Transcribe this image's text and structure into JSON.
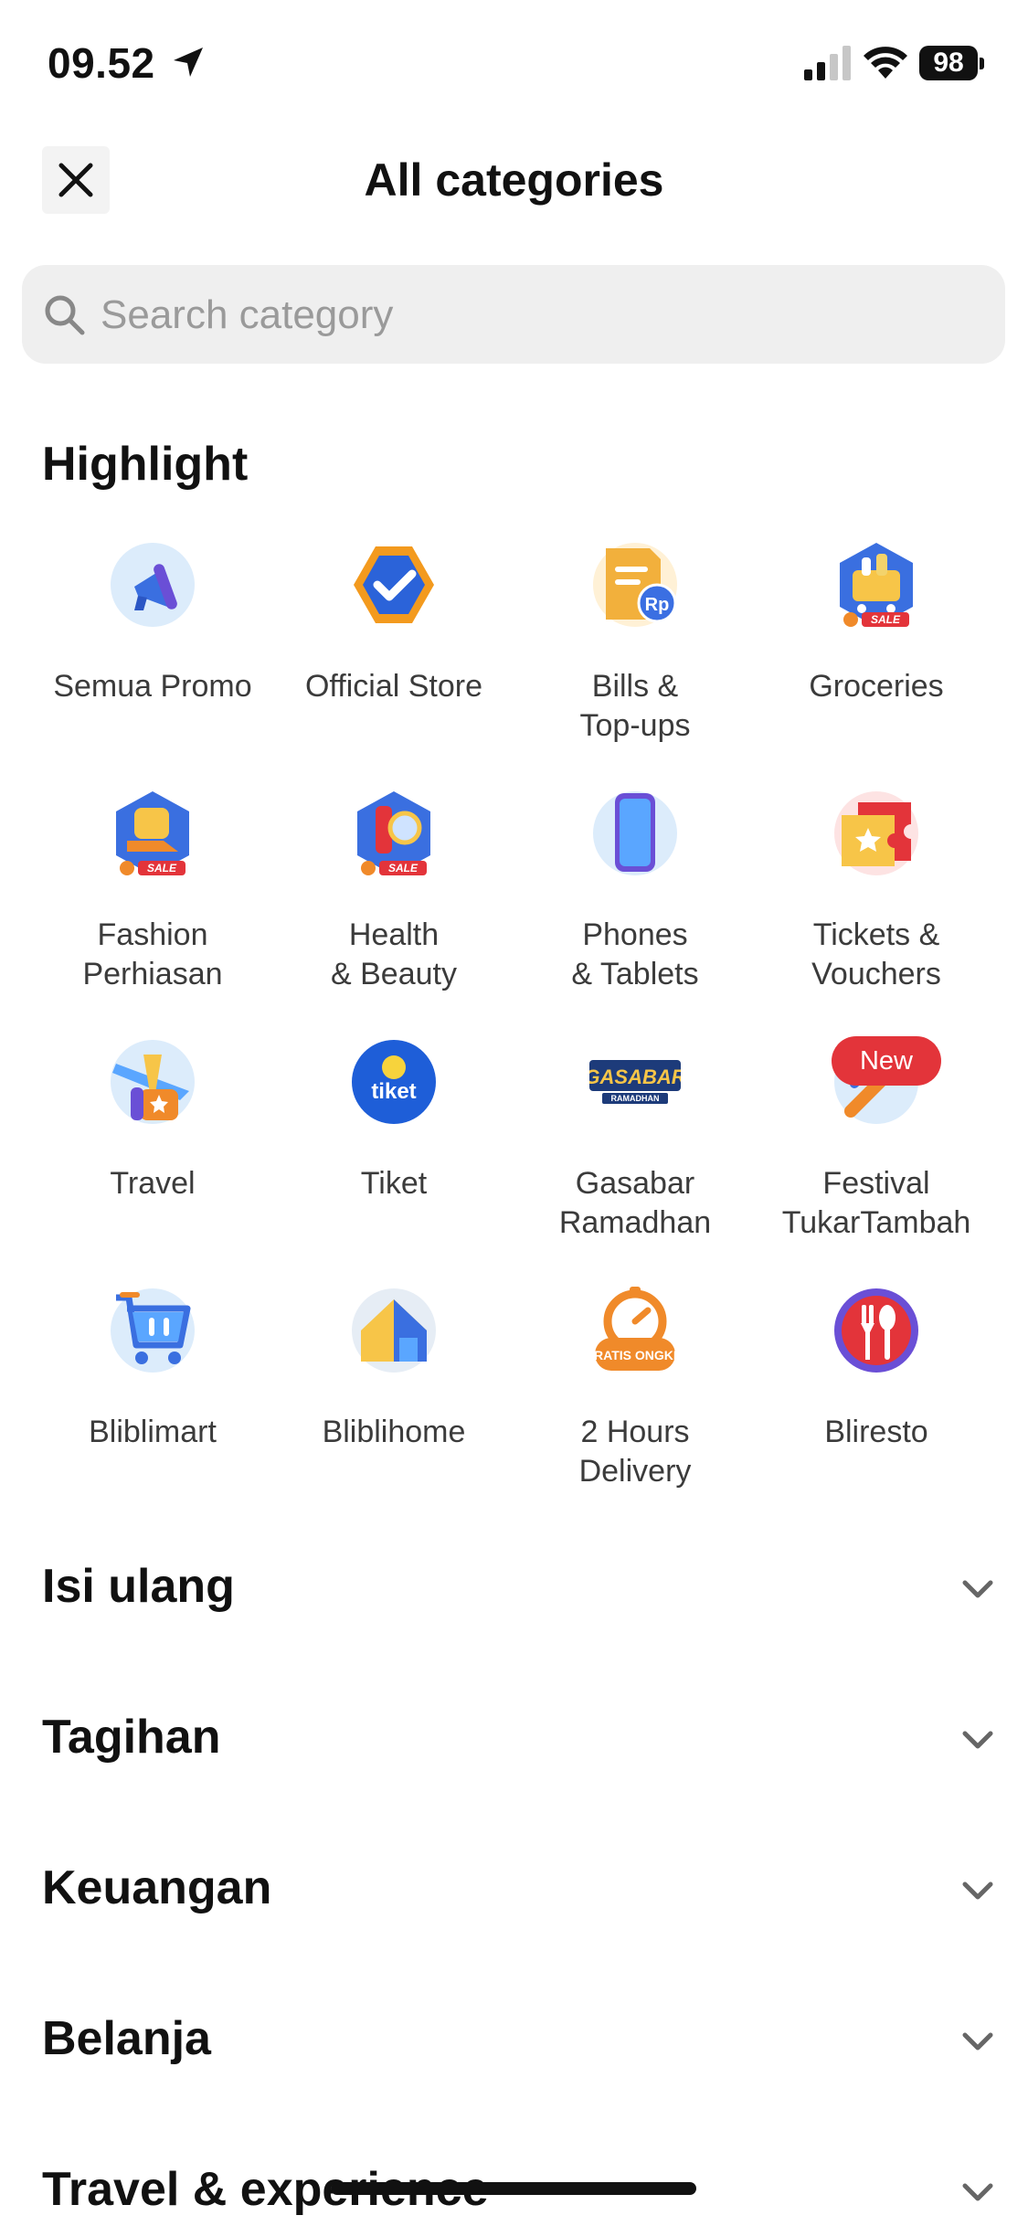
{
  "status_bar": {
    "time": "09.52",
    "battery": "98"
  },
  "header": {
    "title": "All categories"
  },
  "search": {
    "placeholder": "Search category"
  },
  "highlight": {
    "title": "Highlight",
    "items": [
      {
        "label": "Semua Promo",
        "icon": "megaphone-icon"
      },
      {
        "label": "Official Store",
        "icon": "official-store-check-icon"
      },
      {
        "label": "Bills &\nTop-ups",
        "icon": "bill-rp-icon"
      },
      {
        "label": "Groceries",
        "icon": "grocery-basket-icon"
      },
      {
        "label": "Fashion\nPerhiasan",
        "icon": "fashion-shoe-bag-icon"
      },
      {
        "label": "Health\n& Beauty",
        "icon": "health-beauty-icon"
      },
      {
        "label": "Phones\n& Tablets",
        "icon": "phone-icon"
      },
      {
        "label": "Tickets &\nVouchers",
        "icon": "ticket-voucher-icon"
      },
      {
        "label": "Travel",
        "icon": "plane-icon"
      },
      {
        "label": "Tiket",
        "icon": "tiket-logo-icon"
      },
      {
        "label": "Gasabar\nRamadhan",
        "icon": "gasabar-ramadhan-logo-icon"
      },
      {
        "label": "Festival\nTukarTambah",
        "icon": "trade-in-icon"
      },
      {
        "label": "Bliblimart",
        "icon": "shopping-cart-icon"
      },
      {
        "label": "Bliblihome",
        "icon": "house-icon"
      },
      {
        "label": "2 Hours\nDelivery",
        "icon": "gratis-ongkir-icon"
      },
      {
        "label": "Bliresto",
        "icon": "fork-spoon-icon"
      }
    ],
    "new_badge": "New",
    "gasabar_logo_text": "GASABAR",
    "gasabar_logo_sub": "RAMADHAN",
    "tiket_logo_text": "tiket",
    "gratis_ongkir_text": "GRATIS ONGKIR",
    "sale_tag": "SALE",
    "rp_tag": "Rp"
  },
  "sections": [
    {
      "label": "Isi ulang"
    },
    {
      "label": "Tagihan"
    },
    {
      "label": "Keuangan"
    },
    {
      "label": "Belanja"
    },
    {
      "label": "Travel & experience"
    }
  ],
  "colors": {
    "accent_blue": "#1e6ee8",
    "new_badge": "#e3343a",
    "orange": "#f08a2a"
  }
}
